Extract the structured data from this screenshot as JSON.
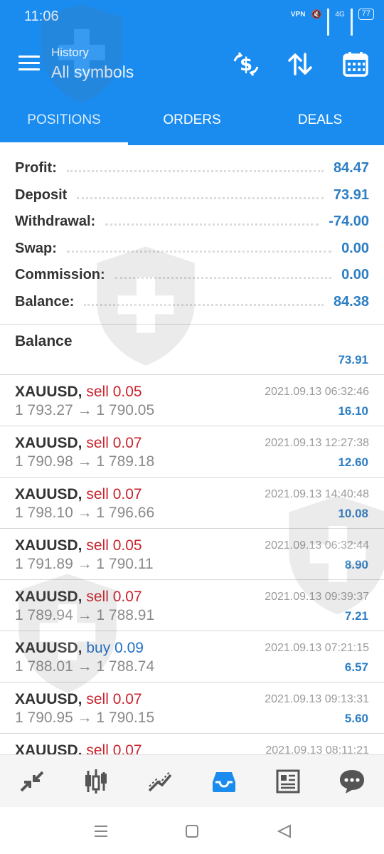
{
  "status_bar": {
    "time": "11:06",
    "vpn": "VPN",
    "network": "4G",
    "battery": "77"
  },
  "toolbar": {
    "subtitle": "History",
    "title": "All symbols"
  },
  "tabs": [
    {
      "label": "POSITIONS",
      "active": true
    },
    {
      "label": "ORDERS",
      "active": false
    },
    {
      "label": "DEALS",
      "active": false
    }
  ],
  "summary": [
    {
      "label": "Profit:",
      "value": "84.47"
    },
    {
      "label": "Deposit",
      "value": "73.91"
    },
    {
      "label": "Withdrawal:",
      "value": "-74.00"
    },
    {
      "label": "Swap:",
      "value": "0.00"
    },
    {
      "label": "Commission:",
      "value": "0.00"
    },
    {
      "label": "Balance:",
      "value": "84.38"
    }
  ],
  "balance_entry": {
    "title": "Balance",
    "value": "73.91"
  },
  "deals": [
    {
      "symbol": "XAUUSD,",
      "direction": "sell 0.05",
      "type": "sell",
      "prices": "1 793.27 → 1 790.05",
      "time": "2021.09.13 06:32:46",
      "profit": "16.10"
    },
    {
      "symbol": "XAUUSD,",
      "direction": "sell 0.07",
      "type": "sell",
      "prices": "1 790.98 → 1 789.18",
      "time": "2021.09.13 12:27:38",
      "profit": "12.60"
    },
    {
      "symbol": "XAUUSD,",
      "direction": "sell 0.07",
      "type": "sell",
      "prices": "1 798.10 → 1 796.66",
      "time": "2021.09.13 14:40:48",
      "profit": "10.08"
    },
    {
      "symbol": "XAUUSD,",
      "direction": "sell 0.05",
      "type": "sell",
      "prices": "1 791.89 → 1 790.11",
      "time": "2021.09.13 06:32:44",
      "profit": "8.90"
    },
    {
      "symbol": "XAUUSD,",
      "direction": "sell 0.07",
      "type": "sell",
      "prices": "1 789.94 → 1 788.91",
      "time": "2021.09.13 09:39:37",
      "profit": "7.21"
    },
    {
      "symbol": "XAUUSD,",
      "direction": "buy 0.09",
      "type": "buy",
      "prices": "1 788.01 → 1 788.74",
      "time": "2021.09.13 07:21:15",
      "profit": "6.57"
    },
    {
      "symbol": "XAUUSD,",
      "direction": "sell 0.07",
      "type": "sell",
      "prices": "1 790.95 → 1 790.15",
      "time": "2021.09.13 09:13:31",
      "profit": "5.60"
    },
    {
      "symbol": "XAUUSD,",
      "direction": "sell 0.07",
      "type": "sell",
      "prices": "",
      "time": "2021.09.13 08:11:21",
      "profit": ""
    }
  ],
  "bottom_nav": [
    {
      "icon": "quotes-arrows-icon",
      "active": false
    },
    {
      "icon": "candlestick-chart-icon",
      "active": false
    },
    {
      "icon": "trade-trend-icon",
      "active": false
    },
    {
      "icon": "history-inbox-icon",
      "active": true
    },
    {
      "icon": "news-icon",
      "active": false
    },
    {
      "icon": "chat-bubble-icon",
      "active": false
    }
  ],
  "colors": {
    "header_blue": "#1a8cf0",
    "value_blue": "#2d7ec4",
    "sell_red": "#c8232c",
    "buy_blue": "#2170c4",
    "active_nav": "#1a8cf0"
  }
}
